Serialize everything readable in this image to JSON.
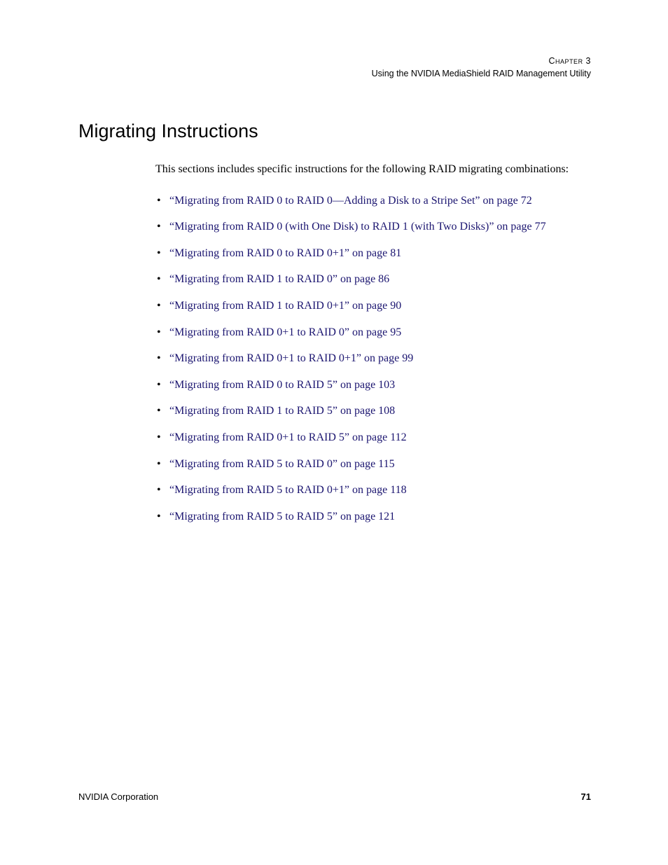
{
  "header": {
    "chapter_label": "Chapter 3",
    "chapter_title": "Using the NVIDIA MediaShield RAID Management Utility"
  },
  "section": {
    "title": "Migrating Instructions",
    "intro": "This sections includes specific instructions for the following RAID migrating combinations:"
  },
  "links": [
    "“Migrating from RAID 0 to RAID 0—Adding a Disk to a Stripe Set” on page 72",
    "“Migrating from RAID 0 (with One Disk) to RAID 1 (with Two Disks)” on page 77",
    "“Migrating from RAID 0 to RAID 0+1” on page 81",
    "“Migrating from RAID 1 to RAID 0” on page 86",
    "“Migrating from RAID 1 to RAID 0+1” on page 90",
    "“Migrating from RAID 0+1 to RAID 0” on page 95",
    "“Migrating from RAID 0+1 to RAID 0+1” on page 99",
    "“Migrating from RAID 0 to RAID 5” on page 103",
    "“Migrating from RAID 1 to RAID 5” on page 108",
    "“Migrating from RAID 0+1 to RAID 5” on page 112",
    "“Migrating from RAID 5 to RAID 0” on page 115",
    "“Migrating from RAID 5 to RAID 0+1” on page 118",
    "“Migrating from RAID 5 to RAID 5” on page 121"
  ],
  "footer": {
    "company": "NVIDIA Corporation",
    "page_number": "71"
  }
}
